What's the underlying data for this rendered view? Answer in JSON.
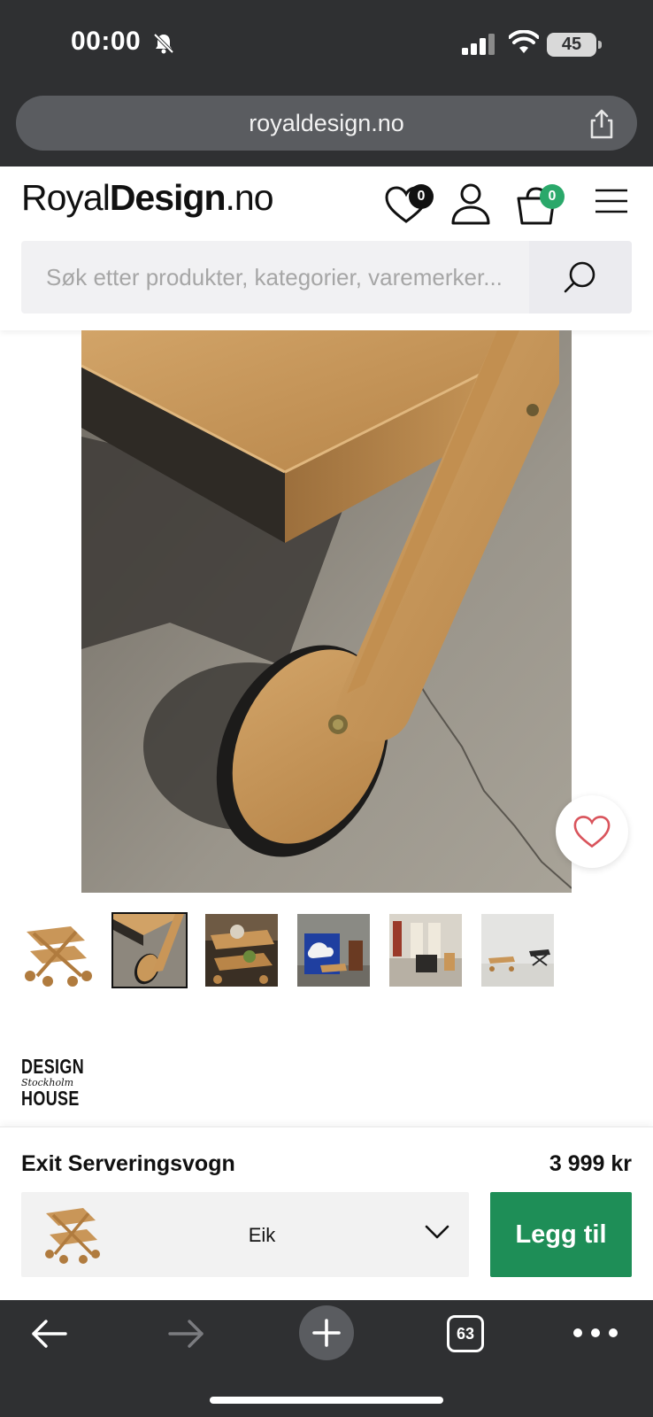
{
  "status_bar": {
    "time": "00:00",
    "battery": "45",
    "icons": [
      "bell-off-icon",
      "signal-icon",
      "wifi-icon",
      "battery-icon"
    ]
  },
  "browser": {
    "url": "royaldesign.no",
    "tab_count": "63",
    "icons": [
      "share-icon",
      "back-icon",
      "forward-icon",
      "plus-icon",
      "tabs-icon",
      "more-icon"
    ]
  },
  "header": {
    "logo": {
      "part1": "Royal",
      "part2": "Design",
      "part3": ".no"
    },
    "wishlist_count": "0",
    "cart_count": "0",
    "accent_green": "#2aa86a",
    "search": {
      "placeholder": "Søk etter produkter, kategorier, varemerker..."
    }
  },
  "gallery": {
    "thumbnail_count": 6,
    "active_thumbnail": 2
  },
  "brand": {
    "line1": "DESIGN",
    "line2": "Stockholm",
    "line3": "HOUSE"
  },
  "purchase": {
    "product_name": "Exit Serveringsvogn",
    "price": "3 999 kr",
    "variant": "Eik",
    "add_label": "Legg til",
    "button_color": "#1e8e57"
  }
}
